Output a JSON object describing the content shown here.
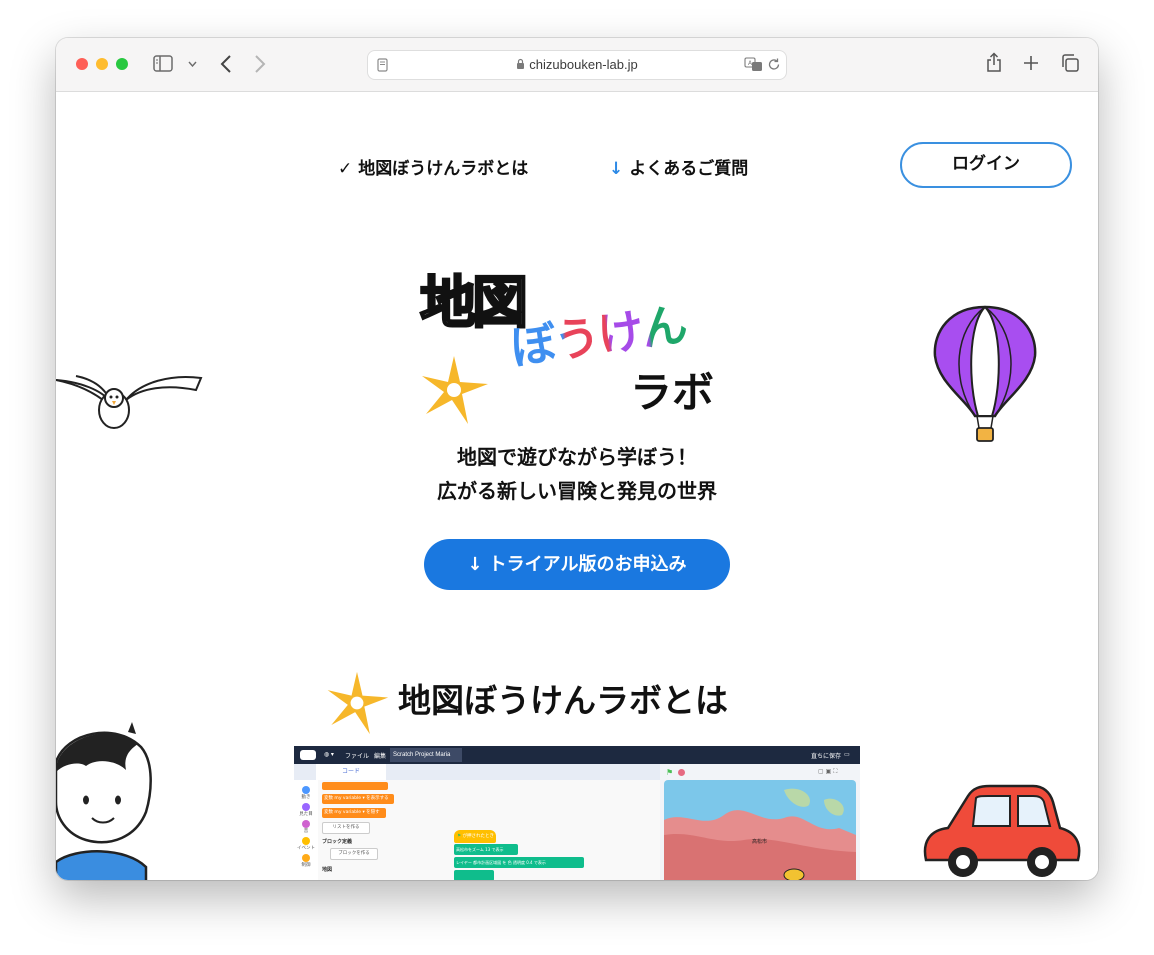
{
  "browser": {
    "url": "chizubouken-lab.jp"
  },
  "nav": {
    "about_label": "地図ぼうけんラボとは",
    "faq_label": "よくあるご質問",
    "login_label": "ログイン"
  },
  "hero": {
    "logo_line1": "地図",
    "logo_line2": "ぼうけん",
    "logo_line3": "ラボ",
    "tagline_line1": "地図で遊びながら学ぼう！",
    "tagline_line2": "広がる新しい冒険と発見の世界",
    "cta_label": "トライアル版のお申込み"
  },
  "about": {
    "title": "地図ぼうけんラボとは"
  },
  "app_preview": {
    "menu_file": "ファイル",
    "menu_edit": "編集",
    "project_name": "Scratch Project Maria",
    "save_label": "直ちに保存",
    "tab_code": "コード",
    "category_motion": "動き",
    "category_looks": "見た目",
    "category_sound": "音",
    "category_events": "イベント",
    "category_control": "制御",
    "block_define": "ブロック定義",
    "block_make": "ブロックを作る",
    "map_section": "地図",
    "var_show": "変数 my variable ▾ を表示する",
    "var_hide": "変数 my variable ▾ を隠す",
    "make_list": "リストを作る",
    "when_flag": "が押されたとき",
    "zoom_block": "高松市をズーム 13 で表示",
    "layer_block": "レイヤー 都市計画区域図 を 色 透明度 0.4 で表示",
    "map_city": "高松市",
    "colors": {
      "accent_blue": "#1a78e0",
      "login_border": "#3a90e0",
      "sparkle": "#f6b72a",
      "balloon_purple": "#a84ef0"
    }
  }
}
